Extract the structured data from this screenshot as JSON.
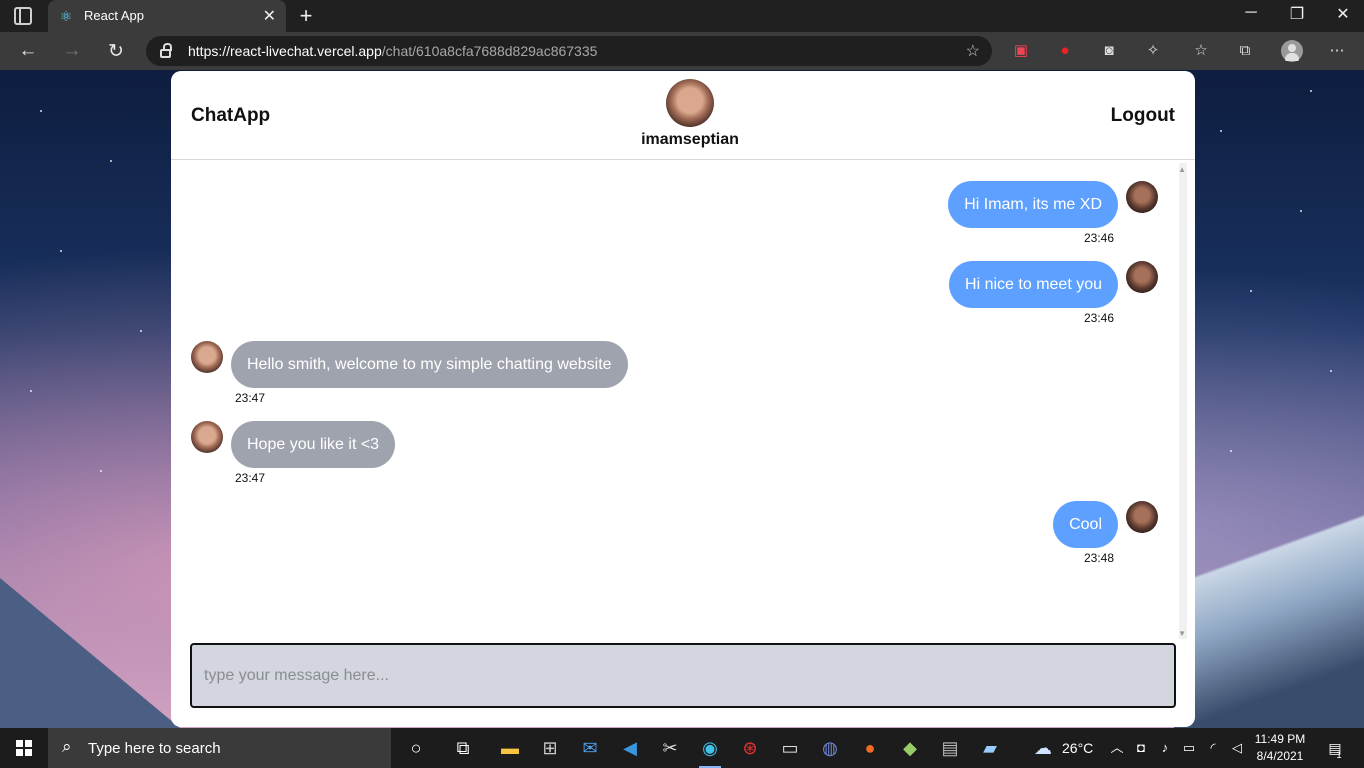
{
  "browser": {
    "tab_title": "React App",
    "url_host": "https://react-livechat.vercel.app",
    "url_path": "/chat/610a8cfa7688d829ac867335"
  },
  "chat": {
    "brand": "ChatApp",
    "contact_name": "imamseptian",
    "logout_label": "Logout",
    "messages": [
      {
        "side": "me",
        "text": "Hi Imam, its me XD",
        "time": "23:46"
      },
      {
        "side": "me",
        "text": "Hi nice to meet you",
        "time": "23:46"
      },
      {
        "side": "them",
        "text": "Hello smith, welcome to my simple chatting website",
        "time": "23:47"
      },
      {
        "side": "them",
        "text": "Hope you like it <3",
        "time": "23:47"
      },
      {
        "side": "me",
        "text": "Cool",
        "time": "23:48"
      }
    ],
    "input_placeholder": "type your message here..."
  },
  "taskbar": {
    "search_placeholder": "Type here to search",
    "weather": "26°C",
    "time": "11:49 PM",
    "date": "8/4/2021",
    "notification_count": "1"
  },
  "icons": {
    "tab_favicon": "react-icon",
    "back": "back-arrow-icon",
    "forward": "forward-arrow-icon",
    "refresh": "refresh-icon"
  }
}
